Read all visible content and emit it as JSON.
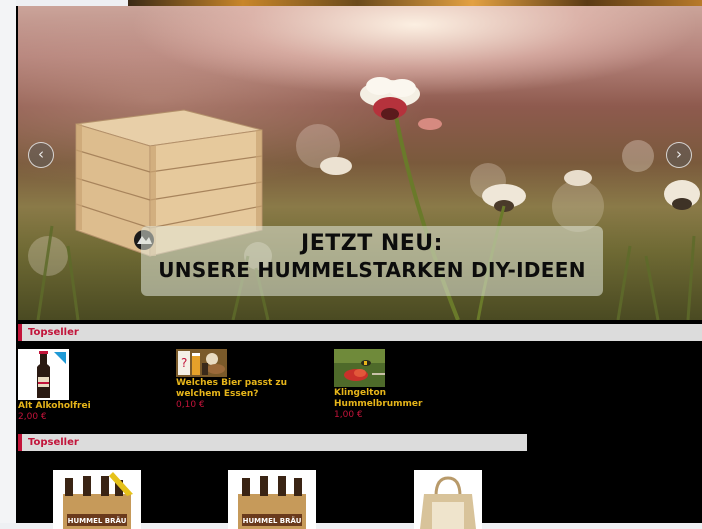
{
  "hero": {
    "line1": "JETZT NEU:",
    "line2": "UNSERE HUMMELSTARKEN DIY-IDEEN",
    "prev_icon": "chevron-left-icon",
    "next_icon": "chevron-right-icon"
  },
  "topseller_1": {
    "title": "Topseller",
    "products": [
      {
        "name": "Alt Alkoholfrei",
        "price": "2,00 €"
      },
      {
        "name": "Welches Bier passt zu welchem Essen?",
        "price": "0,10 €"
      },
      {
        "name": "Klingelton Hummelbrummer",
        "price": "1,00 €"
      }
    ]
  },
  "topseller_2": {
    "title": "Topseller",
    "products": [
      {
        "image_text": "HUMMEL BRÄU"
      },
      {
        "image_text": "HUMMEL BRÄU"
      },
      {
        "image_text": ""
      }
    ]
  },
  "colors": {
    "accent": "#c2143a",
    "product_name": "#e6b51a",
    "background": "#000000"
  }
}
